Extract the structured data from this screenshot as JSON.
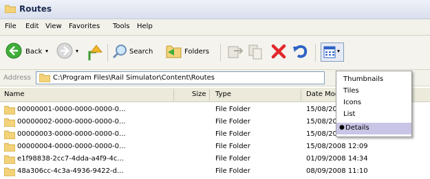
{
  "window": {
    "title": "Routes"
  },
  "menu": [
    "File",
    "Edit",
    "View",
    "Favorites",
    "Tools",
    "Help"
  ],
  "toolbar": {
    "back_label": "Back",
    "search_label": "Search",
    "folders_label": "Folders",
    "icons": [
      "back-icon",
      "forward-icon",
      "up-icon",
      "search-icon",
      "folders-icon",
      "move-icon",
      "copy-icon",
      "delete-icon",
      "undo-icon",
      "views-icon"
    ]
  },
  "address": {
    "label": "Address",
    "path": "C:\\Program Files\\Rail Simulator\\Content\\Routes"
  },
  "columns": [
    "Name",
    "Size",
    "Type",
    "Date Moc"
  ],
  "rows": [
    {
      "name": "00000001-0000-0000-0000-0...",
      "type": "File Folder",
      "date": "15/08/200"
    },
    {
      "name": "00000002-0000-0000-0000-0...",
      "type": "File Folder",
      "date": "15/08/200"
    },
    {
      "name": "00000003-0000-0000-0000-0...",
      "type": "File Folder",
      "date": "15/08/200"
    },
    {
      "name": "00000004-0000-0000-0000-0...",
      "type": "File Folder",
      "date": "15/08/2008 12:09"
    },
    {
      "name": "e1f98838-2cc7-4dda-a4f9-4c...",
      "type": "File Folder",
      "date": "01/09/2008 14:34"
    },
    {
      "name": "48a306cc-4c3a-4936-9422-d...",
      "type": "File Folder",
      "date": "08/09/2008 11:10"
    }
  ],
  "views_menu": {
    "items": [
      "Thumbnails",
      "Tiles",
      "Icons",
      "List",
      "Details"
    ],
    "selected": "Details"
  },
  "colors": {
    "title_text": "#1c2b4f",
    "folder": "#f3d27a",
    "delete": "#e2282a",
    "selected_bg": "#c9c5e6"
  }
}
